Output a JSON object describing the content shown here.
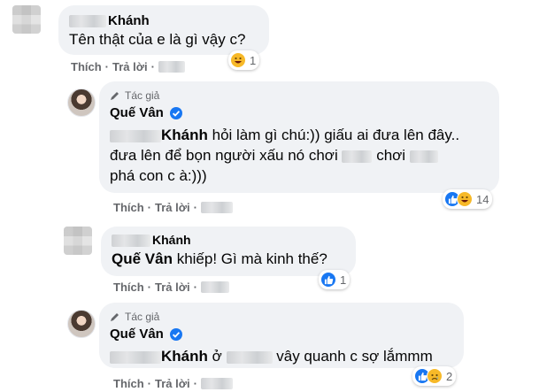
{
  "comments": [
    {
      "author_suffix": "Khánh",
      "text": "Tên thật của e là gì vậy c?",
      "actions": {
        "like": "Thích",
        "reply": "Trả lời"
      },
      "reactions": {
        "count": "1",
        "icons": [
          "haha-icon"
        ]
      }
    },
    {
      "role": "Tác giả",
      "author": "Quế Vân",
      "mention_suffix": "Khánh",
      "line1": "hỏi làm gì chú:)) giấu ai đưa lên đây..",
      "line2_a": "đưa lên để bọn người xấu nó chơi",
      "line2_b": "chơi",
      "line3": "phá con c à:)))",
      "actions": {
        "like": "Thích",
        "reply": "Trả lời"
      },
      "reactions": {
        "count": "14",
        "icons": [
          "like-icon",
          "haha-icon"
        ]
      }
    },
    {
      "author_suffix": "Khánh",
      "mention": "Quế Vân",
      "text": "khiếp! Gì mà kinh thế?",
      "actions": {
        "like": "Thích",
        "reply": "Trả lời"
      },
      "reactions": {
        "count": "1",
        "icons": [
          "like-icon"
        ]
      }
    },
    {
      "role": "Tác giả",
      "author": "Quế Vân",
      "mention_suffix": "Khánh",
      "text_a": "ở",
      "text_b": "vây quanh c sợ lắmmm",
      "actions": {
        "like": "Thích",
        "reply": "Trả lời"
      },
      "reactions": {
        "count": "2",
        "icons": [
          "like-icon",
          "sad-icon"
        ]
      }
    }
  ],
  "colors": {
    "like_blue": "#1877f2",
    "haha_yellow": "#f7b928",
    "verified_blue": "#1877f2",
    "muted": "#65676b",
    "bubble": "#f0f2f5"
  }
}
